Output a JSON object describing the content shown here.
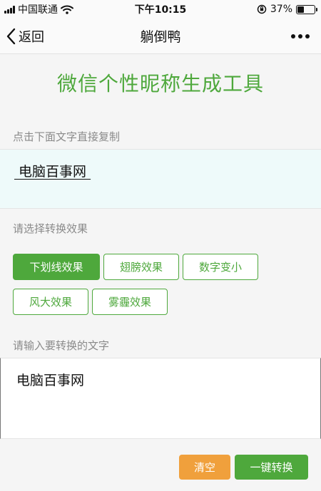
{
  "status_bar": {
    "carrier": "中国联通",
    "time": "下午10:15",
    "battery": "37%",
    "battery_level": 0.37
  },
  "nav": {
    "back_label": "返回",
    "title": "躺倒鸭"
  },
  "heading": "微信个性昵称生成工具",
  "result": {
    "label": "点击下面文字直接复制",
    "text": " 电脑百事网 "
  },
  "effects": {
    "label": "请选择转换效果",
    "items": [
      {
        "label": "下划线效果",
        "active": true
      },
      {
        "label": "翅膀效果",
        "active": false
      },
      {
        "label": "数字变小",
        "active": false
      },
      {
        "label": "风大效果",
        "active": false
      },
      {
        "label": "雾霾效果",
        "active": false
      }
    ]
  },
  "input": {
    "label": "请输入要转换的文字",
    "value": "电脑百事网"
  },
  "actions": {
    "clear_label": "清空",
    "convert_label": "一键转换"
  },
  "colors": {
    "accent": "#4ea83c",
    "clear": "#f0a03c",
    "result_bg": "#eefafa"
  },
  "icons": {
    "back": "chevron-left-icon",
    "more": "more-dots-icon",
    "wifi": "wifi-icon",
    "lock": "orientation-lock-icon"
  }
}
